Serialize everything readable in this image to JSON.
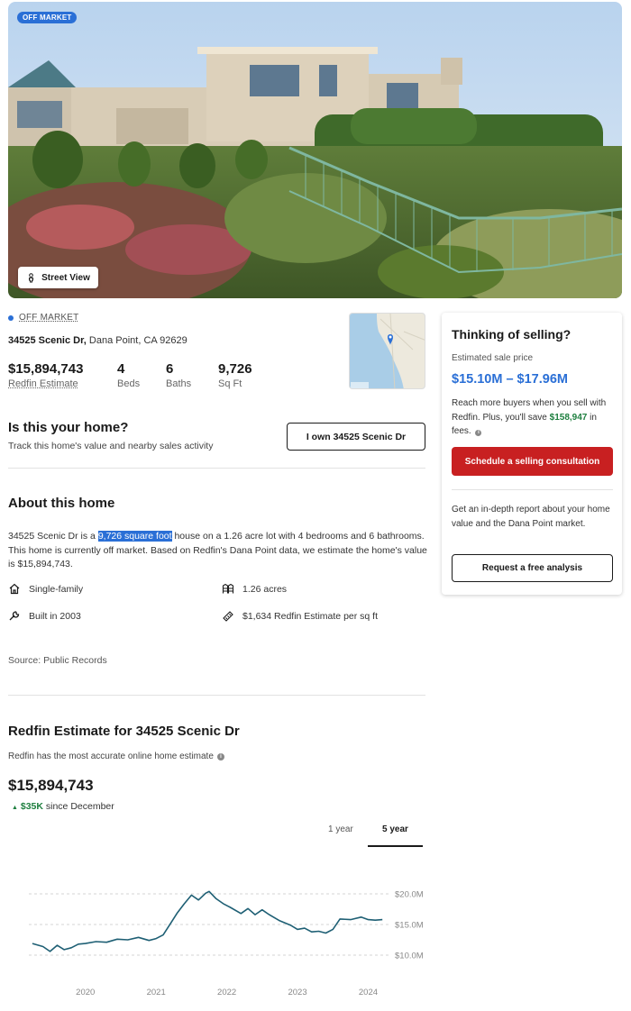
{
  "hero": {
    "badge": "OFF MARKET",
    "street_view_label": "Street View"
  },
  "summary": {
    "status": "OFF MARKET",
    "street": "34525 Scenic Dr,",
    "city": "Dana Point, CA 92629",
    "stats": [
      {
        "value": "$15,894,743",
        "label": "Redfin Estimate"
      },
      {
        "value": "4",
        "label": "Beds"
      },
      {
        "value": "6",
        "label": "Baths"
      },
      {
        "value": "9,726",
        "label": "Sq Ft"
      }
    ]
  },
  "ownership": {
    "title": "Is this your home?",
    "subtitle": "Track this home's value and nearby sales activity",
    "button": "I own 34525 Scenic Dr"
  },
  "about": {
    "title": "About this home",
    "text_before": "34525 Scenic Dr is a ",
    "text_highlight": "9,726 square foot",
    "text_after": " house on a 1.26 acre lot with 4 bedrooms and 6 bathrooms. This home is currently off market. Based on Redfin's Dana Point data, we estimate the home's value is $15,894,743.",
    "facts": [
      {
        "icon": "house-icon",
        "text": "Single-family"
      },
      {
        "icon": "lot-size-icon",
        "text": "1.26 acres"
      },
      {
        "icon": "wrench-icon",
        "text": "Built in 2003"
      },
      {
        "icon": "ruler-icon",
        "text": "$1,634 Redfin Estimate per sq ft"
      }
    ],
    "source": "Source:  Public Records"
  },
  "selling_card": {
    "title": "Thinking of selling?",
    "price_label": "Estimated sale price",
    "price_range": "$15.10M – $17.96M",
    "body_before": "Reach more buyers when you sell with Redfin. Plus, you'll save ",
    "savings": "$158,947",
    "body_after": " in fees.",
    "cta": "Schedule a selling consultation",
    "report_text": "Get an in-depth report about your home value and the Dana Point market.",
    "report_button": "Request a free analysis"
  },
  "estimate": {
    "title": "Redfin Estimate for 34525 Scenic Dr",
    "subtitle": "Redfin has the most accurate online home estimate",
    "value": "$15,894,743",
    "change_amount": "$35K",
    "change_text": " since December",
    "tabs": [
      "1 year",
      "5 year"
    ],
    "active_tab": "5 year"
  },
  "chart_data": {
    "type": "line",
    "title": "",
    "xlabel": "",
    "ylabel": "",
    "x_ticks": [
      "2020",
      "2021",
      "2022",
      "2023",
      "2024"
    ],
    "y_ticks": [
      "$20.0M",
      "$15.0M",
      "$10.0M"
    ],
    "ylim": [
      9.5,
      20.5
    ],
    "xlim": [
      2019.2,
      2024.3
    ],
    "grid": true,
    "color": "#1e5f74",
    "series": [
      {
        "name": "",
        "x": [
          2019.25,
          2019.4,
          2019.5,
          2019.6,
          2019.7,
          2019.8,
          2019.9,
          2020.0,
          2020.15,
          2020.3,
          2020.45,
          2020.6,
          2020.75,
          2020.9,
          2021.0,
          2021.1,
          2021.2,
          2021.3,
          2021.4,
          2021.5,
          2021.6,
          2021.7,
          2021.75,
          2021.85,
          2021.95,
          2022.05,
          2022.2,
          2022.3,
          2022.4,
          2022.5,
          2022.6,
          2022.75,
          2022.9,
          2023.0,
          2023.1,
          2023.2,
          2023.3,
          2023.4,
          2023.5,
          2023.6,
          2023.75,
          2023.9,
          2024.0,
          2024.1,
          2024.2
        ],
        "values": [
          11.9,
          11.4,
          10.6,
          11.6,
          10.9,
          11.2,
          11.8,
          11.9,
          12.2,
          12.1,
          12.6,
          12.5,
          12.9,
          12.4,
          12.7,
          13.3,
          15.1,
          16.9,
          18.4,
          19.8,
          19.0,
          20.1,
          20.4,
          19.2,
          18.4,
          17.8,
          16.8,
          17.6,
          16.6,
          17.4,
          16.6,
          15.6,
          14.9,
          14.2,
          14.4,
          13.8,
          13.9,
          13.6,
          14.2,
          15.9,
          15.8,
          16.2,
          15.8,
          15.7,
          15.8
        ]
      }
    ]
  }
}
